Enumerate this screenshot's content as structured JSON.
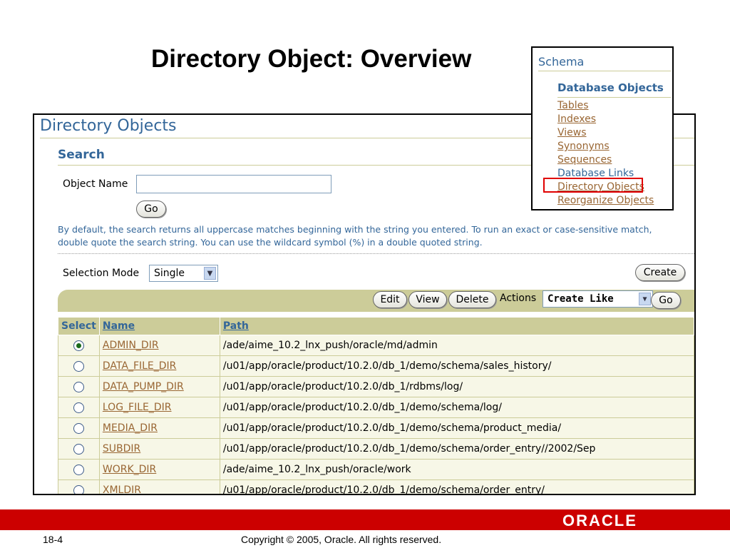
{
  "slide": {
    "title": "Directory Object: Overview",
    "number": "18-4",
    "copyright": "Copyright © 2005, Oracle.  All rights reserved.",
    "logo": "ORACLE",
    "accent_color": "#cc0000"
  },
  "page": {
    "heading": "Directory Objects",
    "search": {
      "heading": "Search",
      "object_name_label": "Object Name",
      "object_name_value": "",
      "go_label": "Go",
      "hint": "By default, the search returns all uppercase matches beginning with the string you entered. To run an exact or case-sensitive match, double quote the search string. You can use the wildcard symbol (%) in a double quoted string."
    },
    "selection_mode": {
      "label": "Selection Mode",
      "value": "Single"
    },
    "create_label": "Create",
    "toolbar": {
      "edit_label": "Edit",
      "view_label": "View",
      "delete_label": "Delete",
      "actions_label": "Actions",
      "actions_value": "Create Like",
      "go_label": "Go"
    },
    "table": {
      "headers": {
        "select": "Select",
        "name": "Name",
        "path": "Path"
      },
      "rows": [
        {
          "selected": true,
          "name": "ADMIN_DIR",
          "path": "/ade/aime_10.2_lnx_push/oracle/md/admin"
        },
        {
          "selected": false,
          "name": "DATA_FILE_DIR",
          "path": "/u01/app/oracle/product/10.2.0/db_1/demo/schema/sales_history/"
        },
        {
          "selected": false,
          "name": "DATA_PUMP_DIR",
          "path": "/u01/app/oracle/product/10.2.0/db_1/rdbms/log/"
        },
        {
          "selected": false,
          "name": "LOG_FILE_DIR",
          "path": "/u01/app/oracle/product/10.2.0/db_1/demo/schema/log/"
        },
        {
          "selected": false,
          "name": "MEDIA_DIR",
          "path": "/u01/app/oracle/product/10.2.0/db_1/demo/schema/product_media/"
        },
        {
          "selected": false,
          "name": "SUBDIR",
          "path": "/u01/app/oracle/product/10.2.0/db_1/demo/schema/order_entry//2002/Sep"
        },
        {
          "selected": false,
          "name": "WORK_DIR",
          "path": "/ade/aime_10.2_lnx_push/oracle/work"
        },
        {
          "selected": false,
          "name": "XMLDIR",
          "path": "/u01/app/oracle/product/10.2.0/db_1/demo/schema/order_entry/"
        }
      ]
    }
  },
  "schema_panel": {
    "title": "Schema",
    "section": "Database Objects",
    "links": [
      "Tables",
      "Indexes",
      "Views",
      "Synonyms",
      "Sequences",
      "Database Links",
      "Directory Objects",
      "Reorganize Objects"
    ]
  }
}
